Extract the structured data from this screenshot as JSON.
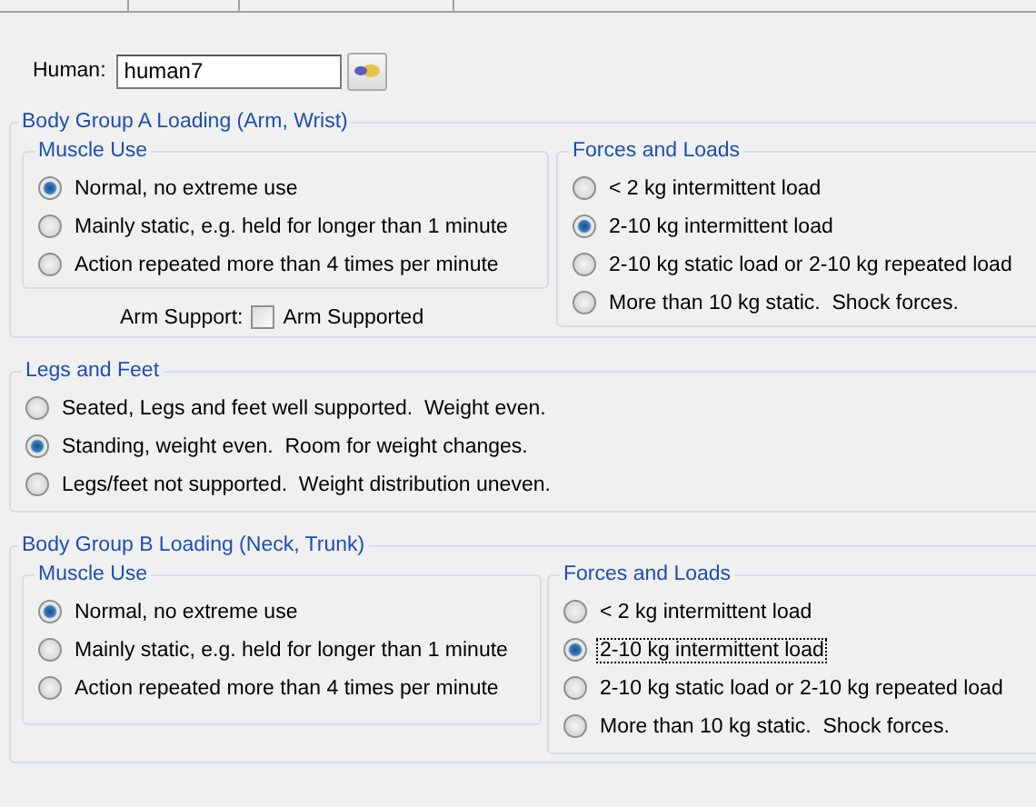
{
  "human": {
    "label": "Human:",
    "value": "human7"
  },
  "groups": [
    {
      "kind": "split",
      "title": "Body Group A Loading (Arm, Wrist)",
      "sections": [
        {
          "title": "Muscle Use",
          "options": [
            {
              "label": "Normal, no extreme use",
              "selected": true,
              "focused": false
            },
            {
              "label": "Mainly static, e.g. held for longer than 1 minute",
              "selected": false,
              "focused": false
            },
            {
              "label": "Action repeated more than 4 times per minute",
              "selected": false,
              "focused": false
            }
          ]
        },
        {
          "title": "Forces and Loads",
          "options": [
            {
              "label": "< 2 kg intermittent load",
              "selected": false,
              "focused": false
            },
            {
              "label": "2-10 kg intermittent load",
              "selected": true,
              "focused": false
            },
            {
              "label": "2-10 kg static load or 2-10 kg repeated load",
              "selected": false,
              "focused": false
            },
            {
              "label": "More than 10 kg static.  Shock forces.",
              "selected": false,
              "focused": false
            }
          ]
        }
      ],
      "support": {
        "label": "Arm Support:",
        "checkbox_label": "Arm Supported",
        "checked": false
      }
    },
    {
      "kind": "simple",
      "title": "Legs and Feet",
      "options": [
        {
          "label": "Seated, Legs and feet well supported.  Weight even.",
          "selected": false,
          "focused": false
        },
        {
          "label": "Standing, weight even.  Room for weight changes.",
          "selected": true,
          "focused": false
        },
        {
          "label": "Legs/feet not supported.  Weight distribution uneven.",
          "selected": false,
          "focused": false
        }
      ]
    },
    {
      "kind": "split",
      "title": "Body Group B Loading (Neck, Trunk)",
      "sections": [
        {
          "title": "Muscle Use",
          "options": [
            {
              "label": "Normal, no extreme use",
              "selected": true,
              "focused": false
            },
            {
              "label": "Mainly static, e.g. held for longer than 1 minute",
              "selected": false,
              "focused": false
            },
            {
              "label": "Action repeated more than 4 times per minute",
              "selected": false,
              "focused": false
            }
          ]
        },
        {
          "title": "Forces and Loads",
          "options": [
            {
              "label": "< 2 kg intermittent load",
              "selected": false,
              "focused": false
            },
            {
              "label": "2-10 kg intermittent load",
              "selected": true,
              "focused": true
            },
            {
              "label": "2-10 kg static load or 2-10 kg repeated load",
              "selected": false,
              "focused": false
            },
            {
              "label": "More than 10 kg static.  Shock forces.",
              "selected": false,
              "focused": false
            }
          ]
        }
      ]
    }
  ]
}
